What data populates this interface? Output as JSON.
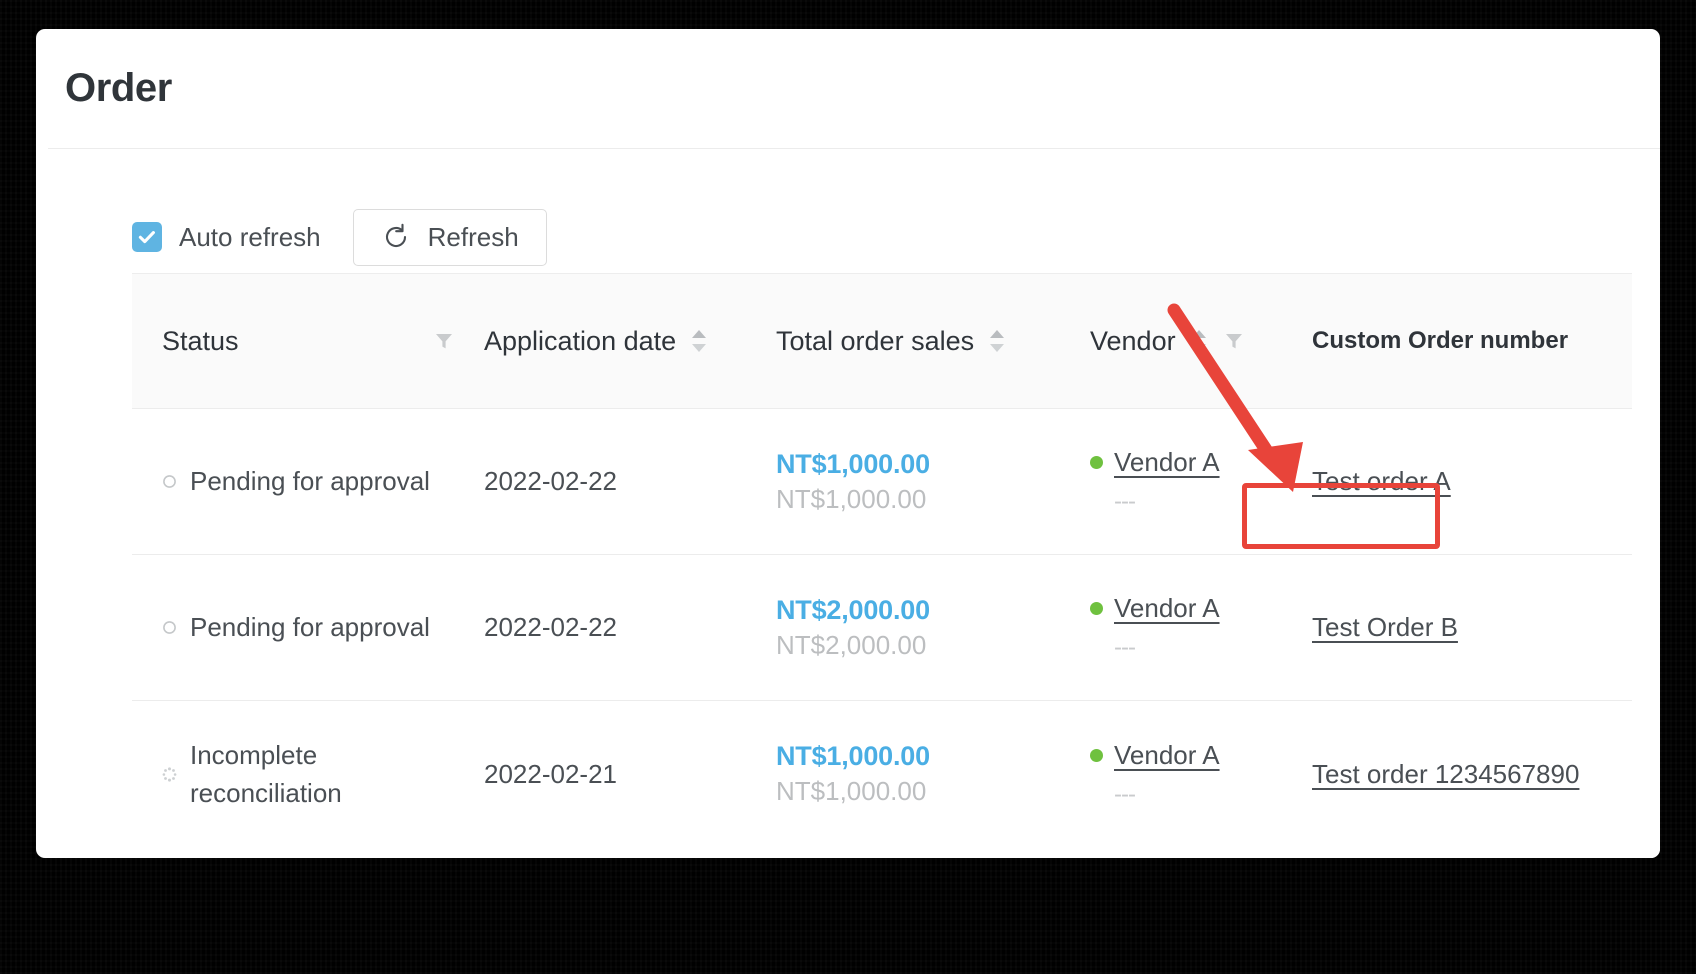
{
  "page": {
    "title": "Order"
  },
  "toolbar": {
    "auto_refresh_label": "Auto refresh",
    "auto_refresh_checked": true,
    "refresh_label": "Refresh",
    "refresh_icon": "refresh-circular-arrow-icon",
    "checkbox_color": "#5fb4e2"
  },
  "table": {
    "columns": [
      {
        "key": "status",
        "label": "Status",
        "filter_icon": "filter-funnel-icon",
        "sort_icon": null
      },
      {
        "key": "date",
        "label": "Application date",
        "filter_icon": null,
        "sort_icon": "sort-updown-icon"
      },
      {
        "key": "sales",
        "label": "Total order sales",
        "filter_icon": null,
        "sort_icon": "sort-updown-icon"
      },
      {
        "key": "vendor",
        "label": "Vendor",
        "filter_icon": "filter-funnel-icon",
        "sort_icon": "sort-updown-icon"
      },
      {
        "key": "custom",
        "label": "Custom Order number",
        "filter_icon": null,
        "sort_icon": null,
        "bold": true
      }
    ],
    "rows": [
      {
        "status": "Pending for approval",
        "status_icon": "hollow-circle-icon",
        "date": "2022-02-22",
        "sales_main": "NT$1,000.00",
        "sales_sub": "NT$1,000.00",
        "vendor": "Vendor A",
        "vendor_sub": "---",
        "vendor_dot_color": "#6fc13f",
        "custom_order_number": "Test order A",
        "highlighted": true
      },
      {
        "status": "Pending for approval",
        "status_icon": "hollow-circle-icon",
        "date": "2022-02-22",
        "sales_main": "NT$2,000.00",
        "sales_sub": "NT$2,000.00",
        "vendor": "Vendor A",
        "vendor_sub": "---",
        "vendor_dot_color": "#6fc13f",
        "custom_order_number": "Test Order B",
        "highlighted": false
      },
      {
        "status": "Incomplete reconciliation",
        "status_icon": "dotted-spinner-icon",
        "date": "2022-02-21",
        "sales_main": "NT$1,000.00",
        "sales_sub": "NT$1,000.00",
        "vendor": "Vendor A",
        "vendor_sub": "---",
        "vendor_dot_color": "#6fc13f",
        "custom_order_number": "Test order 1234567890",
        "highlighted": false
      }
    ]
  },
  "annotation": {
    "color": "#e8443a",
    "arrow_icon": "red-pointer-arrow-icon",
    "box_target": "Test order A"
  }
}
